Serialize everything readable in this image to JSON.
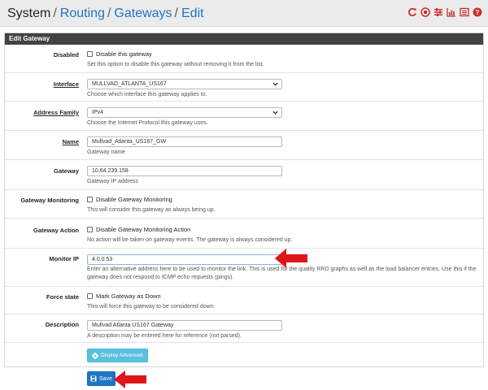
{
  "breadcrumb": {
    "root": "System",
    "items": [
      "Routing",
      "Gateways",
      "Edit"
    ],
    "separator": "/"
  },
  "header_icons": [
    "restart-icon",
    "stop-icon",
    "settings-sliders-icon",
    "chart-icon",
    "list-icon",
    "help-icon"
  ],
  "panel": {
    "title": "Edit Gateway"
  },
  "fields": {
    "disabled": {
      "label": "Disabled",
      "checkbox_label": "Disable this gateway",
      "checked": false,
      "help": "Set this option to disable this gateway without removing it from the list."
    },
    "interface": {
      "label": "Interface",
      "value": "MULLVAD_ATLANTA_US167",
      "help": "Choose which interface this gateway applies to."
    },
    "address_family": {
      "label": "Address Family",
      "value": "IPv4",
      "help": "Choose the Internet Protocol this gateway uses."
    },
    "name": {
      "label": "Name",
      "value": "Mullvad_Atlanta_US167_GW",
      "help": "Gateway name"
    },
    "gateway": {
      "label": "Gateway",
      "value": "10.64.239.158",
      "help": "Gateway IP address"
    },
    "gateway_monitoring": {
      "label": "Gateway Monitoring",
      "checkbox_label": "Disable Gateway Monitoring",
      "checked": false,
      "help": "This will consider this gateway as always being up."
    },
    "gateway_action": {
      "label": "Gateway Action",
      "checkbox_label": "Disable Gateway Monitoring Action",
      "checked": false,
      "help": "No action will be taken on gateway events. The gateway is always considered up."
    },
    "monitor_ip": {
      "label": "Monitor IP",
      "value": "4.0.0.53",
      "help": "Enter an alternative address here to be used to monitor the link. This is used for the quality RRD graphs as well as the load balancer entries. Use this if the gateway does not respond to ICMP echo requests (pings)."
    },
    "force_state": {
      "label": "Force state",
      "checkbox_label": "Mark Gateway as Down",
      "checked": false,
      "help": "This will force this gateway to be considered down."
    },
    "description": {
      "label": "Description",
      "value": "Mullvad Atlanta US167 Gateway",
      "help": "A description may be entered here for reference (not parsed)."
    }
  },
  "buttons": {
    "display_advanced": "Display Advanced",
    "save": "Save"
  },
  "colors": {
    "link": "#1e75c5",
    "header_bg": "#424242",
    "icon_red": "#c9302c",
    "arrow_red": "#e0151b",
    "info_btn": "#5bc0de",
    "primary_btn": "#1e75c5"
  }
}
